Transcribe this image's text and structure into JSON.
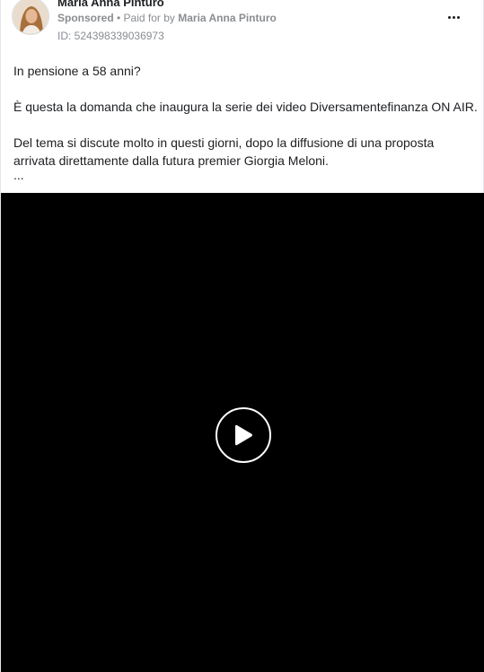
{
  "advertiser": {
    "name": "Maria Anna Pinturo",
    "avatar_icon": "profile-photo"
  },
  "meta": {
    "sponsored": "Sponsored",
    "separator": " • ",
    "paid_for_by": "Paid for by ",
    "payer": "Maria Anna Pinturo"
  },
  "ad_id": "ID: 524398339036973",
  "menu": {
    "icon": "more-options-icon"
  },
  "post": {
    "line1": "In pensione a 58 anni?",
    "line2": "È questa la domanda che inaugura la serie dei video Diversamentefinanza ON AIR.",
    "line3": "Del tema si discute molto in questi giorni, dopo la diffusione di una proposta",
    "line4": "arrivata direttamente dalla futura premier Giorgia Meloni.",
    "truncation": "..."
  },
  "video": {
    "play_icon": "play-icon",
    "background": "#000000"
  }
}
